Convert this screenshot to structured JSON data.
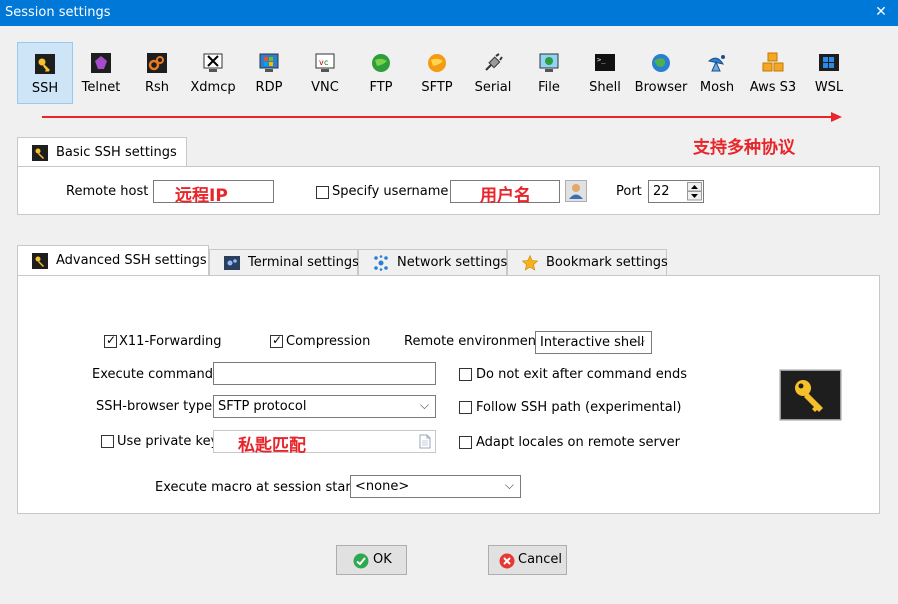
{
  "window": {
    "title": "Session settings",
    "close_glyph": "✕"
  },
  "protocols": [
    {
      "label": "SSH",
      "icon": "ssh-key-icon",
      "active": true
    },
    {
      "label": "Telnet",
      "icon": "telnet-icon"
    },
    {
      "label": "Rsh",
      "icon": "rsh-icon"
    },
    {
      "label": "Xdmcp",
      "icon": "xdmcp-icon"
    },
    {
      "label": "RDP",
      "icon": "rdp-icon"
    },
    {
      "label": "VNC",
      "icon": "vnc-icon"
    },
    {
      "label": "FTP",
      "icon": "ftp-globe-icon"
    },
    {
      "label": "SFTP",
      "icon": "sftp-globe-icon"
    },
    {
      "label": "Serial",
      "icon": "serial-plug-icon"
    },
    {
      "label": "File",
      "icon": "file-monitor-icon"
    },
    {
      "label": "Shell",
      "icon": "shell-terminal-icon"
    },
    {
      "label": "Browser",
      "icon": "browser-globe-icon"
    },
    {
      "label": "Mosh",
      "icon": "mosh-satellite-icon"
    },
    {
      "label": "Aws S3",
      "icon": "aws-s3-cubes-icon"
    },
    {
      "label": "WSL",
      "icon": "wsl-windows-icon"
    }
  ],
  "annotations": {
    "protocols_note": "支持多种协议",
    "remote_host_note": "远程IP",
    "username_note": "用户名",
    "private_key_note": "私匙匹配"
  },
  "basic": {
    "tab_label": "Basic SSH settings",
    "remote_host_label": "Remote host *",
    "remote_host_value": "",
    "specify_username_label": "Specify username",
    "username_value": "",
    "port_label": "Port",
    "port_value": "22"
  },
  "advanced_tabs": [
    {
      "label": "Advanced SSH settings",
      "active": true
    },
    {
      "label": "Terminal settings"
    },
    {
      "label": "Network settings"
    },
    {
      "label": "Bookmark settings"
    }
  ],
  "advanced": {
    "x11_label": "X11-Forwarding",
    "x11_checked": true,
    "compression_label": "Compression",
    "compression_checked": true,
    "remote_env_label": "Remote environment:",
    "remote_env_value": "Interactive shell",
    "exec_cmd_label": "Execute command:",
    "exec_cmd_value": "",
    "no_exit_label": "Do not exit after command ends",
    "browser_type_label": "SSH-browser type:",
    "browser_type_value": "SFTP protocol",
    "follow_path_label": "Follow SSH path (experimental)",
    "use_key_label": "Use private key",
    "adapt_locales_label": "Adapt locales on remote server",
    "macro_label": "Execute macro at session start:",
    "macro_value": "<none>"
  },
  "buttons": {
    "ok": "OK",
    "cancel": "Cancel"
  },
  "colors": {
    "title_bar": "#0078d7",
    "annotation_red": "#e8252a",
    "active_tab_bg": "#ffffff"
  }
}
